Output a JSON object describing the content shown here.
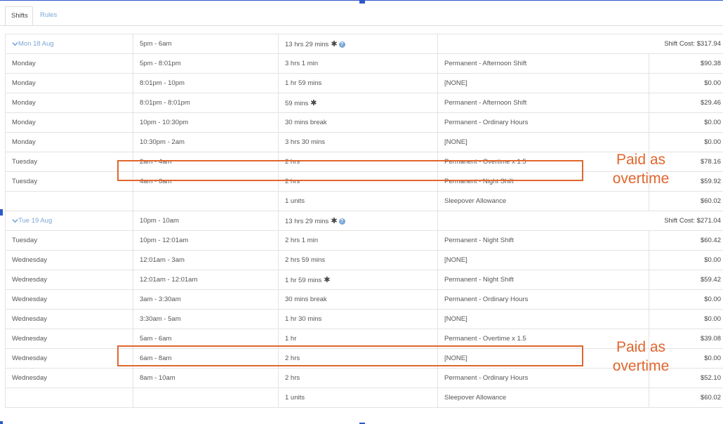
{
  "tabs": [
    {
      "label": "Shifts",
      "active": true
    },
    {
      "label": "Rules",
      "active": false
    }
  ],
  "groups": [
    {
      "date": "Mon 18 Aug",
      "time": "5pm - 6am",
      "duration": "13 hrs 29 mins",
      "total": "Shift Cost: $317.94",
      "rows": [
        {
          "day": "Monday",
          "time": "5pm - 8:01pm",
          "duration": "3 hrs 1 min",
          "type": "Permanent - Afternoon Shift",
          "amount": "$90.38"
        },
        {
          "day": "Monday",
          "time": "8:01pm - 10pm",
          "duration": "1 hr 59 mins",
          "type": "[NONE]",
          "amount": "$0.00"
        },
        {
          "day": "Monday",
          "time": "8:01pm - 8:01pm",
          "duration": "59 mins",
          "type": "Permanent - Afternoon Shift",
          "amount": "$29.46"
        },
        {
          "day": "Monday",
          "time": "10pm - 10:30pm",
          "duration": "30 mins break",
          "type": "Permanent - Ordinary Hours",
          "amount": "$0.00"
        },
        {
          "day": "Monday",
          "time": "10:30pm - 2am",
          "duration": "3 hrs 30 mins",
          "type": "[NONE]",
          "amount": "$0.00"
        },
        {
          "day": "Tuesday",
          "time": "2am - 4am",
          "duration": "2 hrs",
          "type": "Permanent - Overtime x 1.5",
          "amount": "$78.16"
        },
        {
          "day": "Tuesday",
          "time": "4am - 6am",
          "duration": "2 hrs",
          "type": "Permanent - Night Shift",
          "amount": "$59.92"
        },
        {
          "day": "",
          "time": "",
          "duration": "1 units",
          "type": "Sleepover Allowance",
          "amount": "$60.02"
        }
      ]
    },
    {
      "date": "Tue 19 Aug",
      "time": "10pm - 10am",
      "duration": "13 hrs 29 mins",
      "total": "Shift Cost: $271.04",
      "rows": [
        {
          "day": "Tuesday",
          "time": "10pm - 12:01am",
          "duration": "2 hrs 1 min",
          "type": "Permanent - Night Shift",
          "amount": "$60.42"
        },
        {
          "day": "Wednesday",
          "time": "12:01am - 3am",
          "duration": "2 hrs 59 mins",
          "type": "[NONE]",
          "amount": "$0.00"
        },
        {
          "day": "Wednesday",
          "time": "12:01am - 12:01am",
          "duration": "1 hr 59 mins",
          "type": "Permanent - Night Shift",
          "amount": "$59.42"
        },
        {
          "day": "Wednesday",
          "time": "3am - 3:30am",
          "duration": "30 mins break",
          "type": "Permanent - Ordinary Hours",
          "amount": "$0.00"
        },
        {
          "day": "Wednesday",
          "time": "3:30am - 5am",
          "duration": "1 hr 30 mins",
          "type": "[NONE]",
          "amount": "$0.00"
        },
        {
          "day": "Wednesday",
          "time": "5am - 6am",
          "duration": "1 hr",
          "type": "Permanent - Overtime x 1.5",
          "amount": "$39.08"
        },
        {
          "day": "Wednesday",
          "time": "6am - 8am",
          "duration": "2 hrs",
          "type": "[NONE]",
          "amount": "$0.00"
        },
        {
          "day": "Wednesday",
          "time": "8am - 10am",
          "duration": "2 hrs",
          "type": "Permanent - Ordinary Hours",
          "amount": "$52.10"
        },
        {
          "day": "",
          "time": "",
          "duration": "1 units",
          "type": "Sleepover Allowance",
          "amount": "$60.02"
        }
      ]
    }
  ],
  "annotations": [
    {
      "line1": "Paid as",
      "line2": "overtime"
    },
    {
      "line1": "Paid as",
      "line2": "overtime"
    }
  ],
  "colors": {
    "accent": "#7aa7d6",
    "highlight": "#e0662e",
    "border": "#e3e3e3"
  },
  "icons": {
    "expand": "chevron-down-icon",
    "note": "asterisk-icon",
    "help": "help-circle-icon"
  }
}
